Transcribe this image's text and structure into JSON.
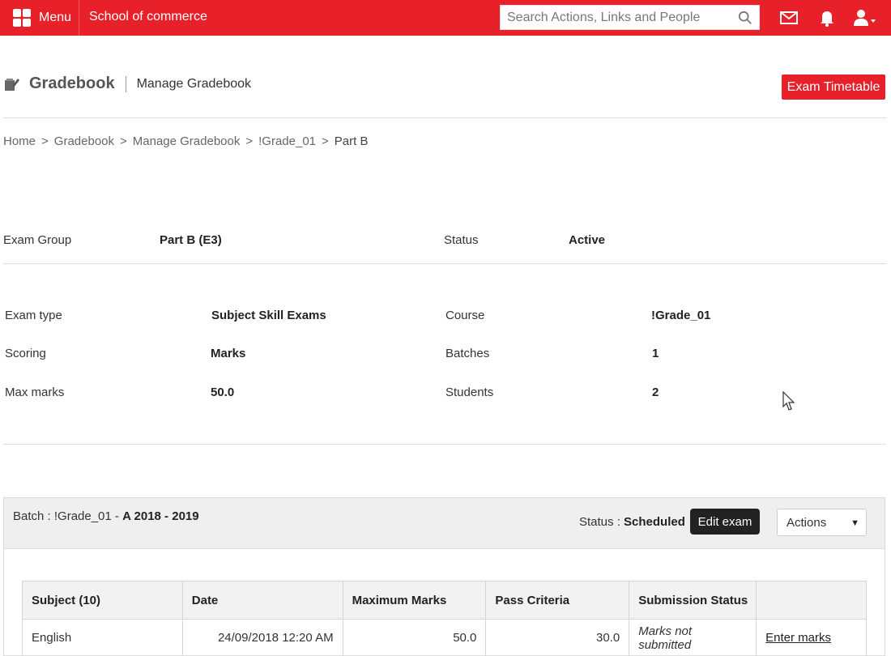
{
  "topbar": {
    "menu_label": "Menu",
    "school_name": "School of commerce",
    "search_placeholder": "Search Actions, Links and People",
    "brand_color": "#e8202a"
  },
  "header": {
    "title": "Gradebook",
    "subtitle": "Manage Gradebook",
    "timetable_button": "Exam Timetable"
  },
  "breadcrumb": {
    "items": [
      "Home",
      "Gradebook",
      "Manage Gradebook",
      "!Grade_01",
      "Part B"
    ],
    "separator": ">"
  },
  "summary": {
    "exam_group_label": "Exam Group",
    "exam_group_value": "Part B (E3)",
    "status_label": "Status",
    "status_value": "Active"
  },
  "details": {
    "exam_type_label": "Exam type",
    "exam_type_value": "Subject Skill Exams",
    "scoring_label": "Scoring",
    "scoring_value": "Marks",
    "max_marks_label": "Max marks",
    "max_marks_value": "50.0",
    "course_label": "Course",
    "course_value": "!Grade_01",
    "batches_label": "Batches",
    "batches_value": "1",
    "students_label": "Students",
    "students_value": "2"
  },
  "batch": {
    "prefix": "Batch : !Grade_01 - ",
    "name": "A 2018 - 2019",
    "status_label": "Status : ",
    "status_value": "Scheduled",
    "edit_button": "Edit exam",
    "actions_select": "Actions"
  },
  "table": {
    "headers": [
      "Subject (10)",
      "Date",
      "Maximum Marks",
      "Pass Criteria",
      "Submission Status",
      ""
    ],
    "rows": [
      {
        "subject": "English",
        "date": "24/09/2018 12:20 AM",
        "max_marks": "50.0",
        "pass_criteria": "30.0",
        "submission_status": "Marks not submitted",
        "action": "Enter marks"
      }
    ]
  }
}
